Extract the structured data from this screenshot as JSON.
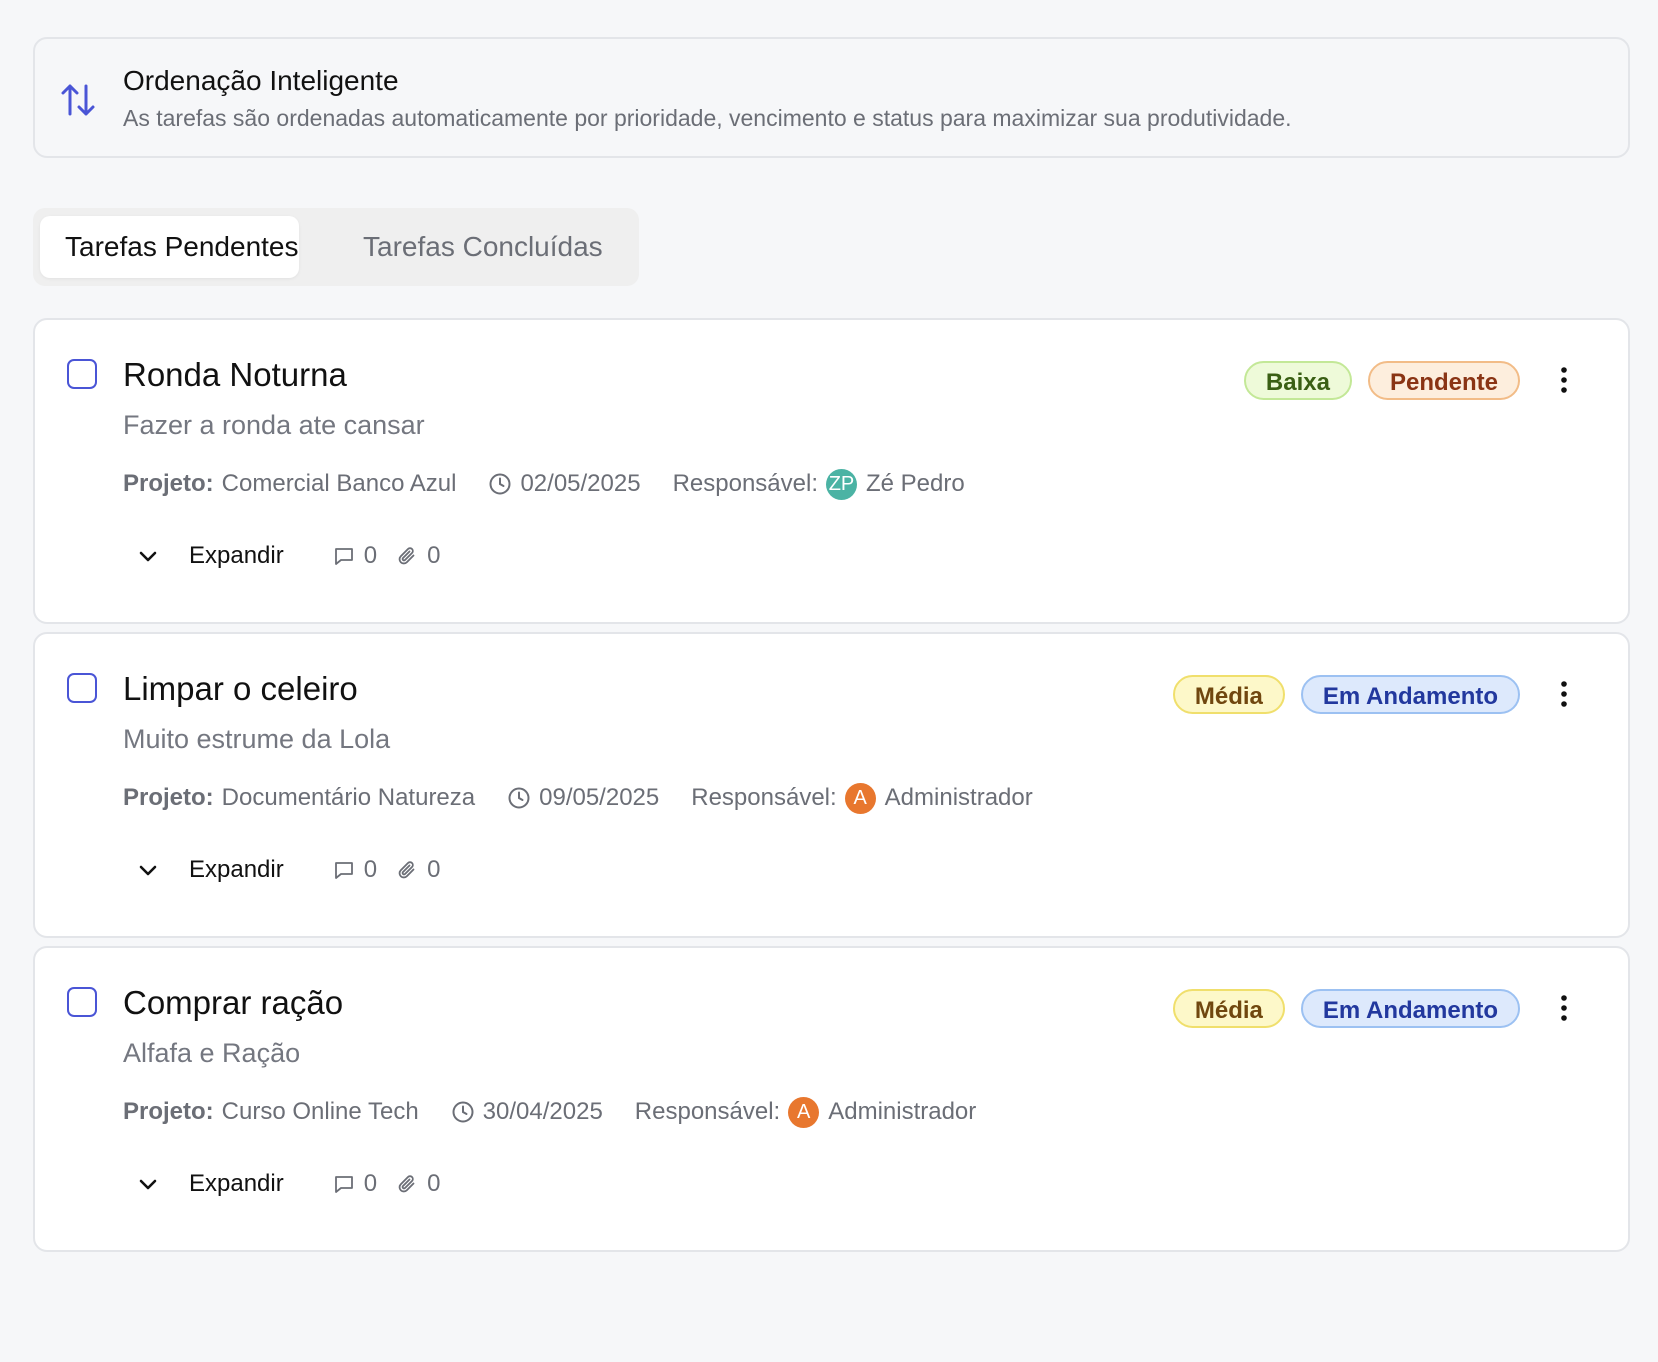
{
  "info": {
    "title": "Ordenação Inteligente",
    "description": "As tarefas são ordenadas automaticamente por prioridade, vencimento e status para maximizar sua produtividade.",
    "icon": "sort-arrows-icon",
    "accent": "#4a55d6"
  },
  "tabs": [
    {
      "label": "Tarefas Pendentes",
      "active": true
    },
    {
      "label": "Tarefas Concluídas",
      "active": false
    }
  ],
  "labels": {
    "project": "Projeto:",
    "responsible": "Responsável:",
    "expand": "Expandir"
  },
  "tasks": [
    {
      "title": "Ronda Noturna",
      "description": "Fazer a ronda ate cansar",
      "project": "Comercial Banco Azul",
      "date": "02/05/2025",
      "assignee": "Zé Pedro",
      "initials": "ZP",
      "avatar_color": "#4bb3a4",
      "priority": "Baixa",
      "status": "Pendente",
      "comments": "0",
      "attachments": "0"
    },
    {
      "title": "Limpar o celeiro",
      "description": "Muito estrume da Lola",
      "project": "Documentário Natureza",
      "date": "09/05/2025",
      "assignee": "Administrador",
      "initials": "A",
      "avatar_color": "#e8772e",
      "priority": "Média",
      "status": "Em Andamento",
      "comments": "0",
      "attachments": "0"
    },
    {
      "title": "Comprar ração",
      "description": "Alfafa e Ração",
      "project": "Curso Online Tech",
      "date": "30/04/2025",
      "assignee": "Administrador",
      "initials": "A",
      "avatar_color": "#e8772e",
      "priority": "Média",
      "status": "Em Andamento",
      "comments": "0",
      "attachments": "0"
    }
  ]
}
